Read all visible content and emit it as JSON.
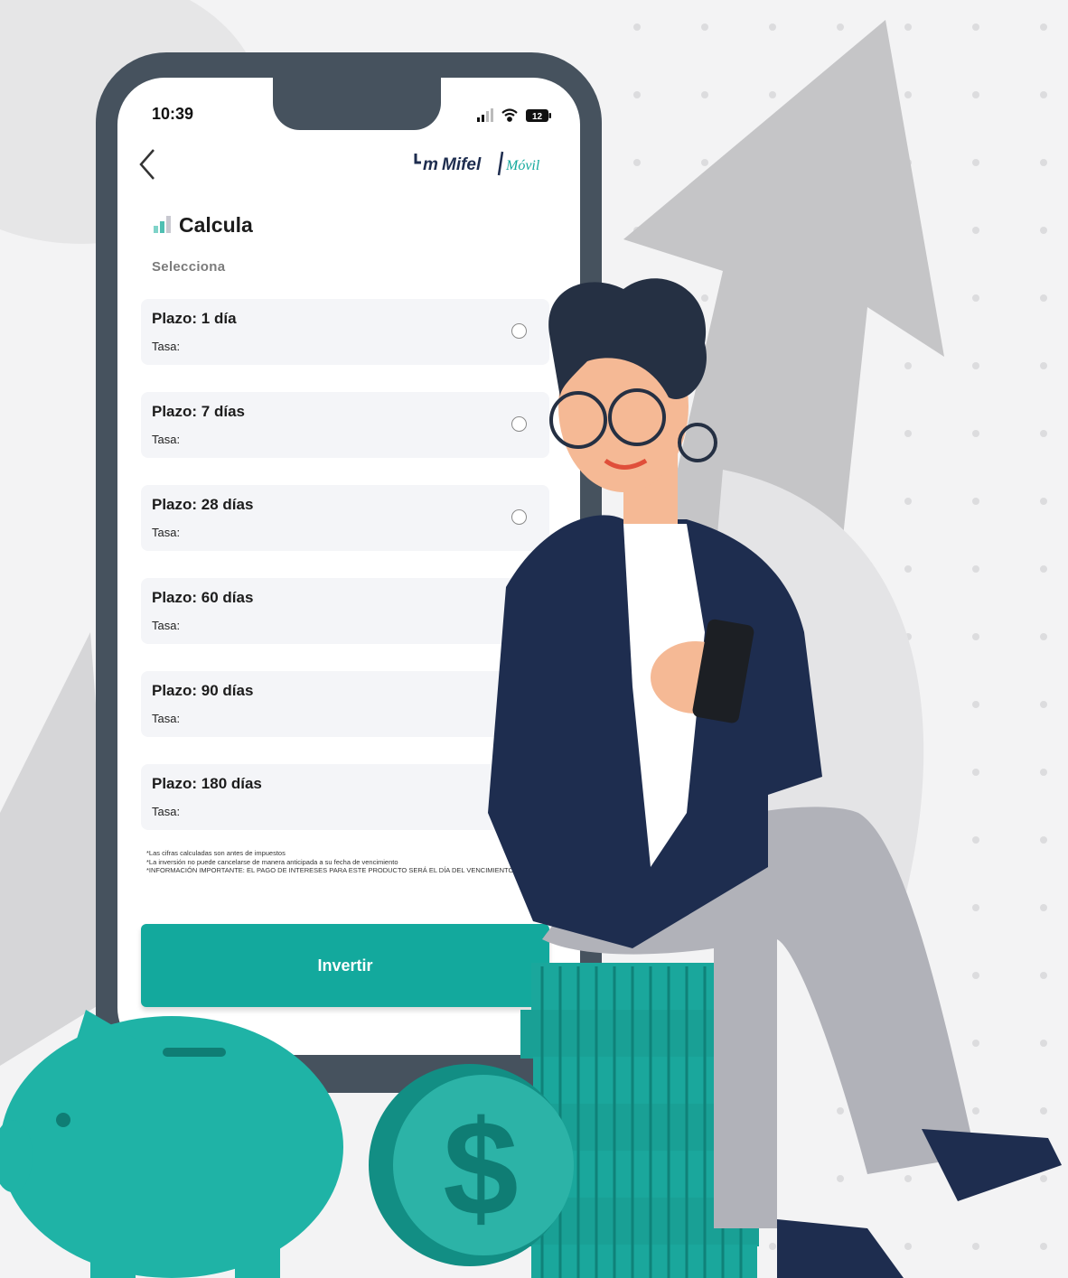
{
  "status_bar": {
    "time": "10:39",
    "battery": "12"
  },
  "header": {
    "back_label": "Back",
    "logo_main": "Mifel",
    "logo_sub": "Móvil"
  },
  "calc": {
    "title": "Calcula",
    "select_label": "Selecciona",
    "options": [
      {
        "plazo": "Plazo: 1 día",
        "tasa": "Tasa:"
      },
      {
        "plazo": "Plazo: 7 días",
        "tasa": "Tasa:"
      },
      {
        "plazo": "Plazo: 28 días",
        "tasa": "Tasa:"
      },
      {
        "plazo": "Plazo: 60 días",
        "tasa": "Tasa:"
      },
      {
        "plazo": "Plazo: 90 días",
        "tasa": "Tasa:"
      },
      {
        "plazo": "Plazo: 180 días",
        "tasa": "Tasa:"
      }
    ],
    "notes": [
      "*Las cifras calculadas son antes de impuestos",
      "*La inversión no puede cancelarse de manera anticipada a su fecha de vencimiento",
      "*INFORMACIÓN IMPORTANTE: EL PAGO DE INTERESES PARA ESTE PRODUCTO SERÁ EL DÍA DEL VENCIMIENTO"
    ],
    "invest_button": "Invertir"
  },
  "colors": {
    "accent": "#13a99d",
    "phone_frame": "#46525e",
    "navy": "#1e2d4f"
  },
  "icons": [
    "chevron-left-icon",
    "signal-icon",
    "wifi-icon",
    "battery-icon",
    "calculator-icon",
    "radio-icon",
    "piggy-bank-icon",
    "dollar-coin-icon"
  ]
}
